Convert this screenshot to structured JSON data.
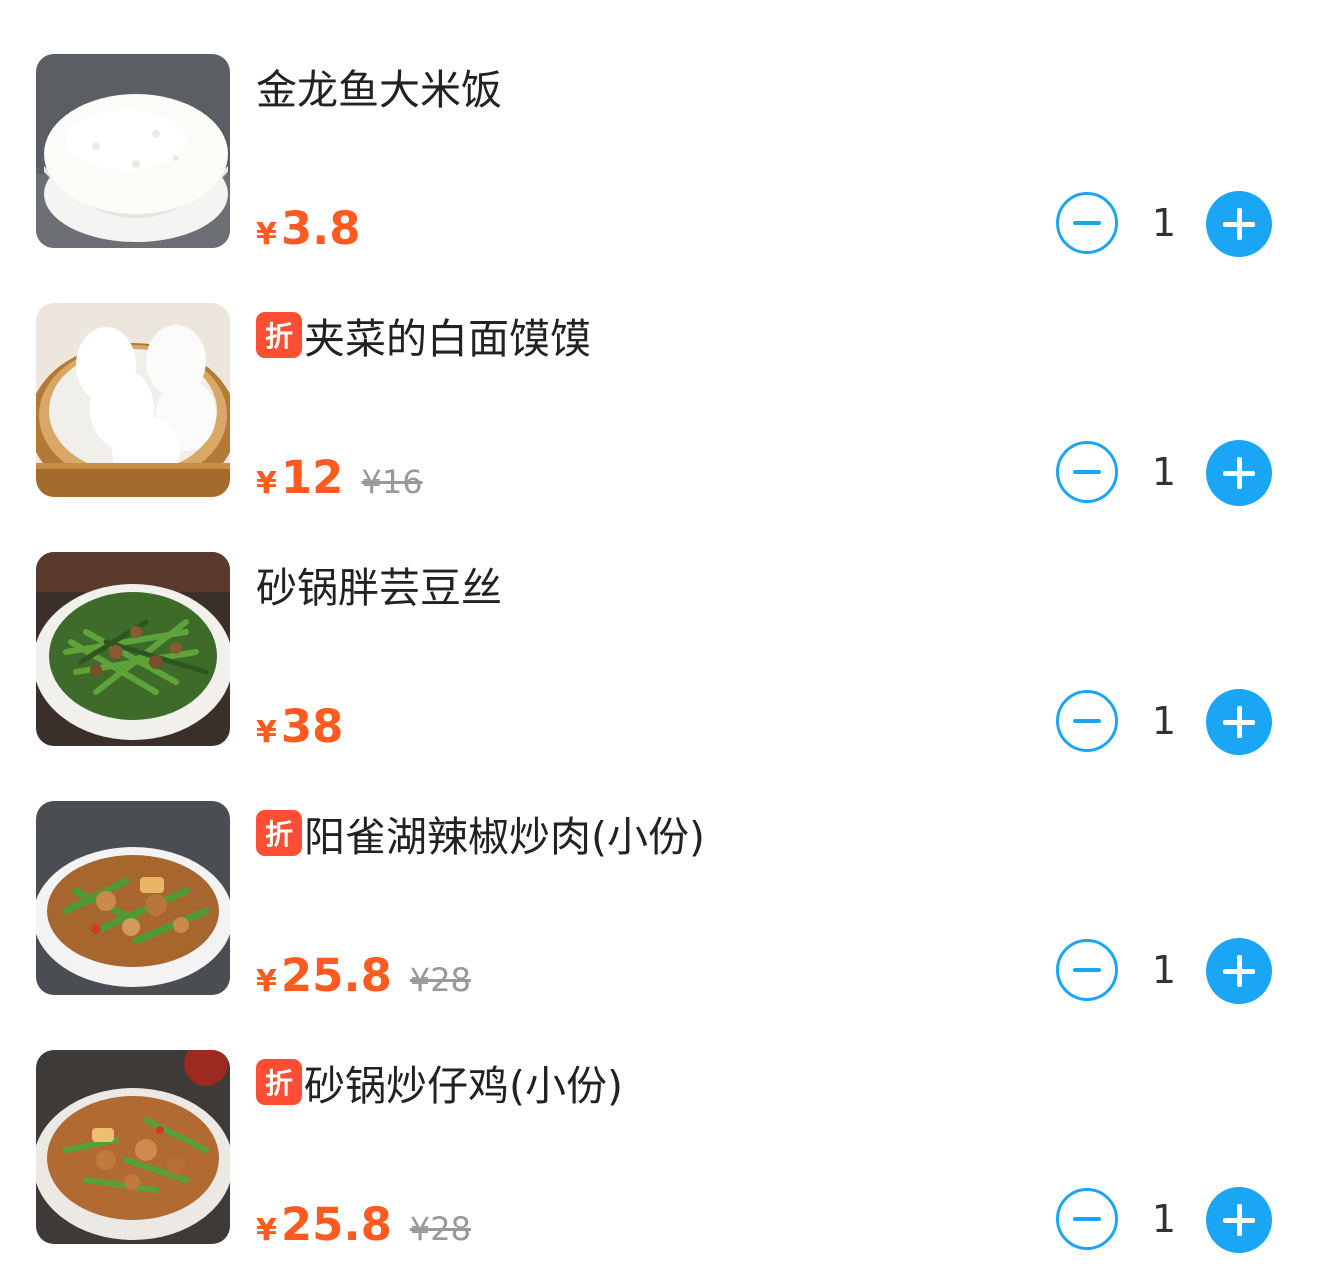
{
  "currency_symbol": "¥",
  "colors": {
    "accent": "#1aa6f4",
    "price": "#ff5a1f",
    "discount_tag": "#ff4e33"
  },
  "items": [
    {
      "name": "金龙鱼大米饭",
      "tag": "",
      "price": "3.8",
      "original_price": "",
      "quantity": "1",
      "image": "rice-bowl"
    },
    {
      "name": "夹菜的白面馍馍",
      "tag": "折",
      "price": "12",
      "original_price": "¥16",
      "quantity": "1",
      "image": "steamed-buns"
    },
    {
      "name": "砂锅胖芸豆丝",
      "tag": "",
      "price": "38",
      "original_price": "",
      "quantity": "1",
      "image": "green-beans-pot"
    },
    {
      "name": "阳雀湖辣椒炒肉(小份)",
      "tag": "折",
      "price": "25.8",
      "original_price": "¥28",
      "quantity": "1",
      "image": "pepper-pork-plate"
    },
    {
      "name": "砂锅炒仔鸡(小份)",
      "tag": "折",
      "price": "25.8",
      "original_price": "¥28",
      "quantity": "1",
      "image": "chicken-pot"
    }
  ]
}
